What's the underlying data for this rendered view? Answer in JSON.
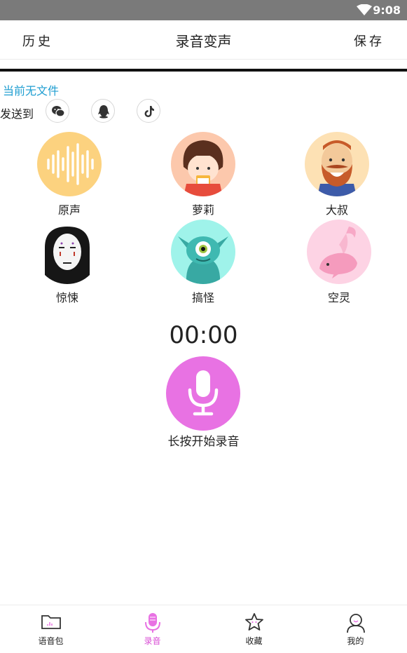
{
  "status_bar": {
    "time": "9:08"
  },
  "header": {
    "left": "历史",
    "title": "录音变声",
    "right": "保存"
  },
  "file_status": "当前无文件",
  "send_to": {
    "label": "发送到",
    "targets": [
      "wechat-icon",
      "qq-icon",
      "tiktok-icon"
    ]
  },
  "voices": [
    {
      "label": "原声",
      "icon": "waveform-icon",
      "color": "#fcd27f"
    },
    {
      "label": "萝莉",
      "icon": "girl-icon",
      "color": "#fcc8ac"
    },
    {
      "label": "大叔",
      "icon": "uncle-icon",
      "color": "#fde1b4"
    },
    {
      "label": "惊悚",
      "icon": "no-face-icon",
      "color": "#ffffff"
    },
    {
      "label": "搞怪",
      "icon": "monster-icon",
      "color": "#9ff3ea"
    },
    {
      "label": "空灵",
      "icon": "dolphin-icon",
      "color": "#fdd3e4"
    }
  ],
  "recorder": {
    "timer": "00:00",
    "hint": "长按开始录音",
    "accent": "#e872e3"
  },
  "tabs": [
    {
      "label": "语音包",
      "icon": "folder-icon",
      "active": false
    },
    {
      "label": "录音",
      "icon": "mic-icon",
      "active": true
    },
    {
      "label": "收藏",
      "icon": "star-icon",
      "active": false
    },
    {
      "label": "我的",
      "icon": "user-icon",
      "active": false
    }
  ]
}
